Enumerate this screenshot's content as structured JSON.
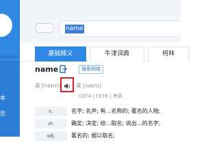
{
  "sidebar": {
    "items": [
      {
        "label": "本"
      },
      {
        "label": "页"
      }
    ]
  },
  "toolbar": {
    "back_glyph": "‹",
    "forward_glyph": "›",
    "search_value": "name"
  },
  "tabs": [
    {
      "label": "基础释义",
      "active": true
    },
    {
      "label": "牛津词典",
      "active": false
    },
    {
      "label": "柯林"
    }
  ],
  "entry": {
    "word": "name",
    "web_search_label": "搜索网络",
    "uk_prefix": "英",
    "uk_phonetic": "[neɪm]",
    "us_prefix": "美",
    "us_phonetic": "[neɪm]",
    "exam_tags": "CET4 | CET6 | 考研",
    "definitions": [
      {
        "pos": "n.",
        "meaning": "名字; 名声; 有…名称的; 著名的人物;"
      },
      {
        "pos": "vt.",
        "meaning": "确定; 决定; 给…取名; 说出…的名字;"
      },
      {
        "pos": "adj.",
        "meaning": "著名的; 据以取名;"
      }
    ]
  },
  "colors": {
    "sidebar": "#2b7dd6",
    "tab_active": "#2f88e4",
    "highlight": "#e8191d",
    "selection": "#3d7ddc"
  },
  "icons": [
    "user-avatar",
    "back-arrow-icon",
    "forward-arrow-icon",
    "word-book-icon",
    "speaker-icon"
  ]
}
